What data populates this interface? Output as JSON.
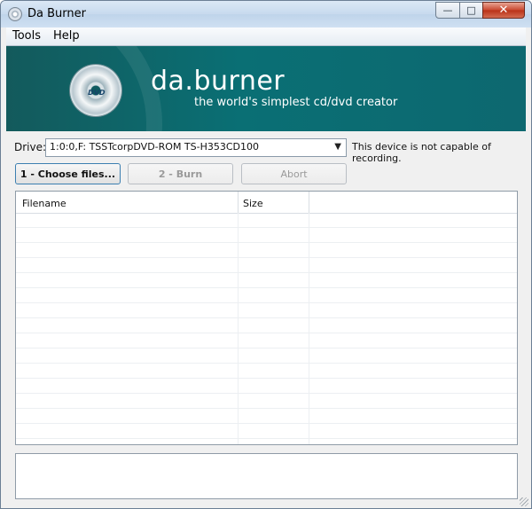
{
  "window": {
    "title": "Da Burner",
    "controls": {
      "minimize": "—",
      "maximize": "□",
      "close": "✕"
    }
  },
  "menu": {
    "items": [
      "Tools",
      "Help"
    ]
  },
  "banner": {
    "title": "da.burner",
    "tagline": "the world's simplest cd/dvd creator",
    "disc_label": "DVD"
  },
  "drive": {
    "label": "Drive:",
    "selected": "1:0:0,F: TSSTcorpDVD-ROM TS-H353CD100",
    "status": "This device is not capable of recording."
  },
  "buttons": {
    "choose": "1 - Choose files...",
    "burn": "2 - Burn",
    "abort": "Abort"
  },
  "file_list": {
    "columns": [
      "Filename",
      "Size"
    ]
  },
  "icons": {
    "app": "disc-icon",
    "dropdown": "chevron-down-icon",
    "resize": "resize-grip-icon"
  }
}
